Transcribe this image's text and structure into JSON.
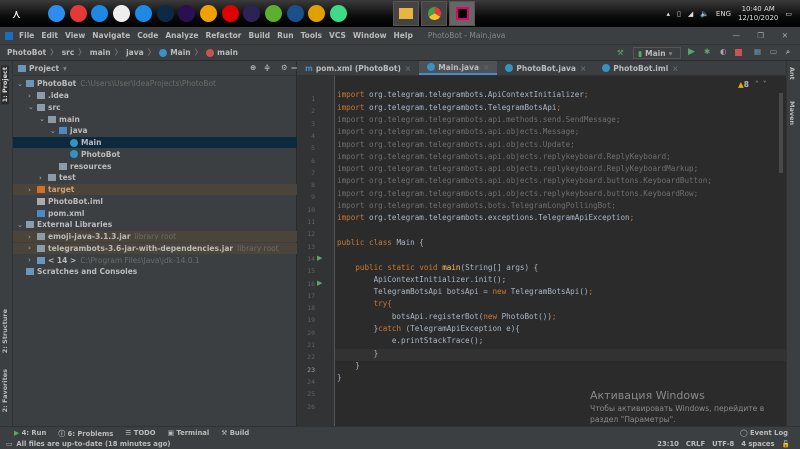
{
  "taskbar": {
    "apps": [
      {
        "name": "share-icon",
        "color": "#2d8cf0"
      },
      {
        "name": "video-icon",
        "color": "#e53935"
      },
      {
        "name": "vscode-icon",
        "color": "#1e88e5"
      },
      {
        "name": "gmail-icon",
        "color": "#eeeeee"
      },
      {
        "name": "arrow-app-icon",
        "color": "#1e88e5"
      },
      {
        "name": "photoshop-icon",
        "color": "#0d2a44"
      },
      {
        "name": "after-effects-icon",
        "color": "#2a1050"
      },
      {
        "name": "aimp-icon",
        "color": "#f0a000"
      },
      {
        "name": "record-icon",
        "color": "#e00000"
      },
      {
        "name": "eclipse-icon",
        "color": "#2c2255"
      },
      {
        "name": "utorrent-icon",
        "color": "#5bb030"
      },
      {
        "name": "java-icon",
        "color": "#1b4f8a"
      },
      {
        "name": "chrome-icon",
        "color": "#e0a000"
      },
      {
        "name": "android-studio-icon",
        "color": "#3ddc84"
      }
    ],
    "tray": {
      "lang": "ENG",
      "time": "10:40 AM",
      "date": "12/10/2020"
    }
  },
  "window": {
    "title": "PhotoBot - Main.java"
  },
  "menu": [
    "File",
    "Edit",
    "View",
    "Navigate",
    "Code",
    "Analyze",
    "Refactor",
    "Build",
    "Run",
    "Tools",
    "VCS",
    "Window",
    "Help"
  ],
  "breadcrumb": [
    "PhotoBot",
    "src",
    "main",
    "java",
    "Main",
    "main"
  ],
  "run_config": "Main",
  "left_tabs": {
    "project": "1: Project",
    "structure": "2: Structure",
    "favorites": "2: Favorites"
  },
  "right_tabs": {
    "ant": "Ant",
    "maven": "Maven"
  },
  "project": {
    "header": "Project",
    "tree": [
      {
        "label": "PhotoBot",
        "hint": "C:\\Users\\User\\IdeaProjects\\PhotoBot",
        "depth": 0,
        "arrow": "v",
        "icon": "module"
      },
      {
        "label": ".idea",
        "depth": 1,
        "arrow": ">",
        "icon": "folder"
      },
      {
        "label": "src",
        "depth": 1,
        "arrow": "v",
        "icon": "folder"
      },
      {
        "label": "main",
        "depth": 2,
        "arrow": "v",
        "icon": "folder"
      },
      {
        "label": "java",
        "depth": 3,
        "arrow": "v",
        "icon": "src"
      },
      {
        "label": "Main",
        "depth": 4,
        "icon": "class",
        "selected": true
      },
      {
        "label": "PhotoBot",
        "depth": 4,
        "icon": "class"
      },
      {
        "label": "resources",
        "depth": 3,
        "icon": "folder"
      },
      {
        "label": "test",
        "depth": 2,
        "arrow": ">",
        "icon": "folder"
      },
      {
        "label": "target",
        "depth": 1,
        "arrow": ">",
        "icon": "excluded",
        "highlight": true
      },
      {
        "label": "PhotoBot.iml",
        "depth": 1,
        "icon": "iml"
      },
      {
        "label": "pom.xml",
        "depth": 1,
        "icon": "maven"
      },
      {
        "label": "External Libraries",
        "depth": 0,
        "arrow": "v",
        "icon": "lib"
      },
      {
        "label": "emoji-java-3.1.3.jar",
        "hint": "library root",
        "depth": 1,
        "arrow": ">",
        "icon": "jar",
        "highlight": true
      },
      {
        "label": "telegrambots-3.6-jar-with-dependencies.jar",
        "hint": "library root",
        "depth": 1,
        "arrow": ">",
        "icon": "jar",
        "highlight": true
      },
      {
        "label": "< 14 >",
        "hint": "C:\\Program Files\\Java\\jdk-14.0.1",
        "depth": 1,
        "arrow": ">",
        "icon": "jdk"
      },
      {
        "label": "Scratches and Consoles",
        "depth": 0,
        "icon": "scratch"
      }
    ]
  },
  "tabs": [
    {
      "label": "pom.xml (PhotoBot)"
    },
    {
      "label": "Main.java",
      "active": true
    },
    {
      "label": "PhotoBot.java"
    },
    {
      "label": "PhotoBot.iml"
    }
  ],
  "inspections": "8",
  "code": [
    "",
    "import org.telegram.telegrambots.ApiContextInitializer;",
    "import org.telegram.telegrambots.TelegramBotsApi;",
    "import org.telegram.telegrambots.api.methods.send.SendMessage;",
    "import org.telegram.telegrambots.api.objects.Message;",
    "import org.telegram.telegrambots.api.objects.Update;",
    "import org.telegram.telegrambots.api.objects.replykeyboard.ReplyKeyboard;",
    "import org.telegram.telegrambots.api.objects.replykeyboard.ReplyKeyboardMarkup;",
    "import org.telegram.telegrambots.api.objects.replykeyboard.buttons.KeyboardButton;",
    "import org.telegram.telegrambots.api.objects.replykeyboard.buttons.KeyboardRow;",
    "import org.telegram.telegrambots.bots.TelegramLongPollingBot;",
    "import org.telegram.telegrambots.exceptions.TelegramApiException;",
    "",
    "public class Main {",
    "",
    "    public static void main(String[] args) {",
    "        ApiContextInitializer.init();",
    "        TelegramBotsApi botsApi = new TelegramBotsApi();",
    "        try{",
    "            botsApi.registerBot(new PhotoBot());",
    "        }catch (TelegramApiException e){",
    "            e.printStackTrace();",
    "        }",
    "    }",
    "}",
    ""
  ],
  "watermark": {
    "title": "Активация Windows",
    "line1": "Чтобы активировать Windows, перейдите в",
    "line2": "раздел \"Параметры\"."
  },
  "tool_buttons": [
    "4: Run",
    "6: Problems",
    "TODO",
    "Terminal",
    "Build"
  ],
  "event_log": "Event Log",
  "status": {
    "message": "All files are up-to-date (18 minutes ago)",
    "position": "23:10",
    "line_sep": "CRLF",
    "encoding": "UTF-8",
    "indent": "4 spaces"
  }
}
